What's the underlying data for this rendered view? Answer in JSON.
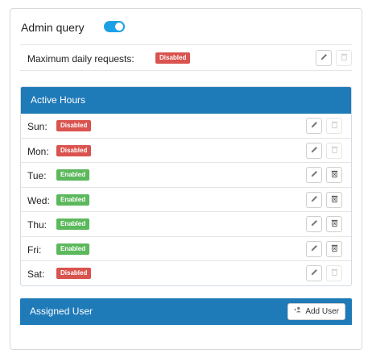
{
  "admin": {
    "label": "Admin query",
    "toggle_on": true
  },
  "max_requests": {
    "label": "Maximum daily requests:",
    "status": "Disabled",
    "status_color": "#d9534f"
  },
  "active_hours": {
    "title": "Active Hours",
    "days": [
      {
        "label": "Sun:",
        "status": "Disabled"
      },
      {
        "label": "Mon:",
        "status": "Disabled"
      },
      {
        "label": "Tue:",
        "status": "Enabled"
      },
      {
        "label": "Wed:",
        "status": "Enabled"
      },
      {
        "label": "Thu:",
        "status": "Enabled"
      },
      {
        "label": "Fri:",
        "status": "Enabled"
      },
      {
        "label": "Sat:",
        "status": "Disabled"
      }
    ]
  },
  "assigned_user": {
    "title": "Assigned User",
    "add_button_label": "Add User"
  },
  "colors": {
    "accent": "#1f7ab8",
    "toggle": "#1da1e6",
    "disabled": "#d9534f",
    "enabled": "#5cb85c"
  },
  "icons": {
    "edit": "pencil-icon",
    "delete": "trash-icon",
    "add_user": "add-user-icon"
  }
}
